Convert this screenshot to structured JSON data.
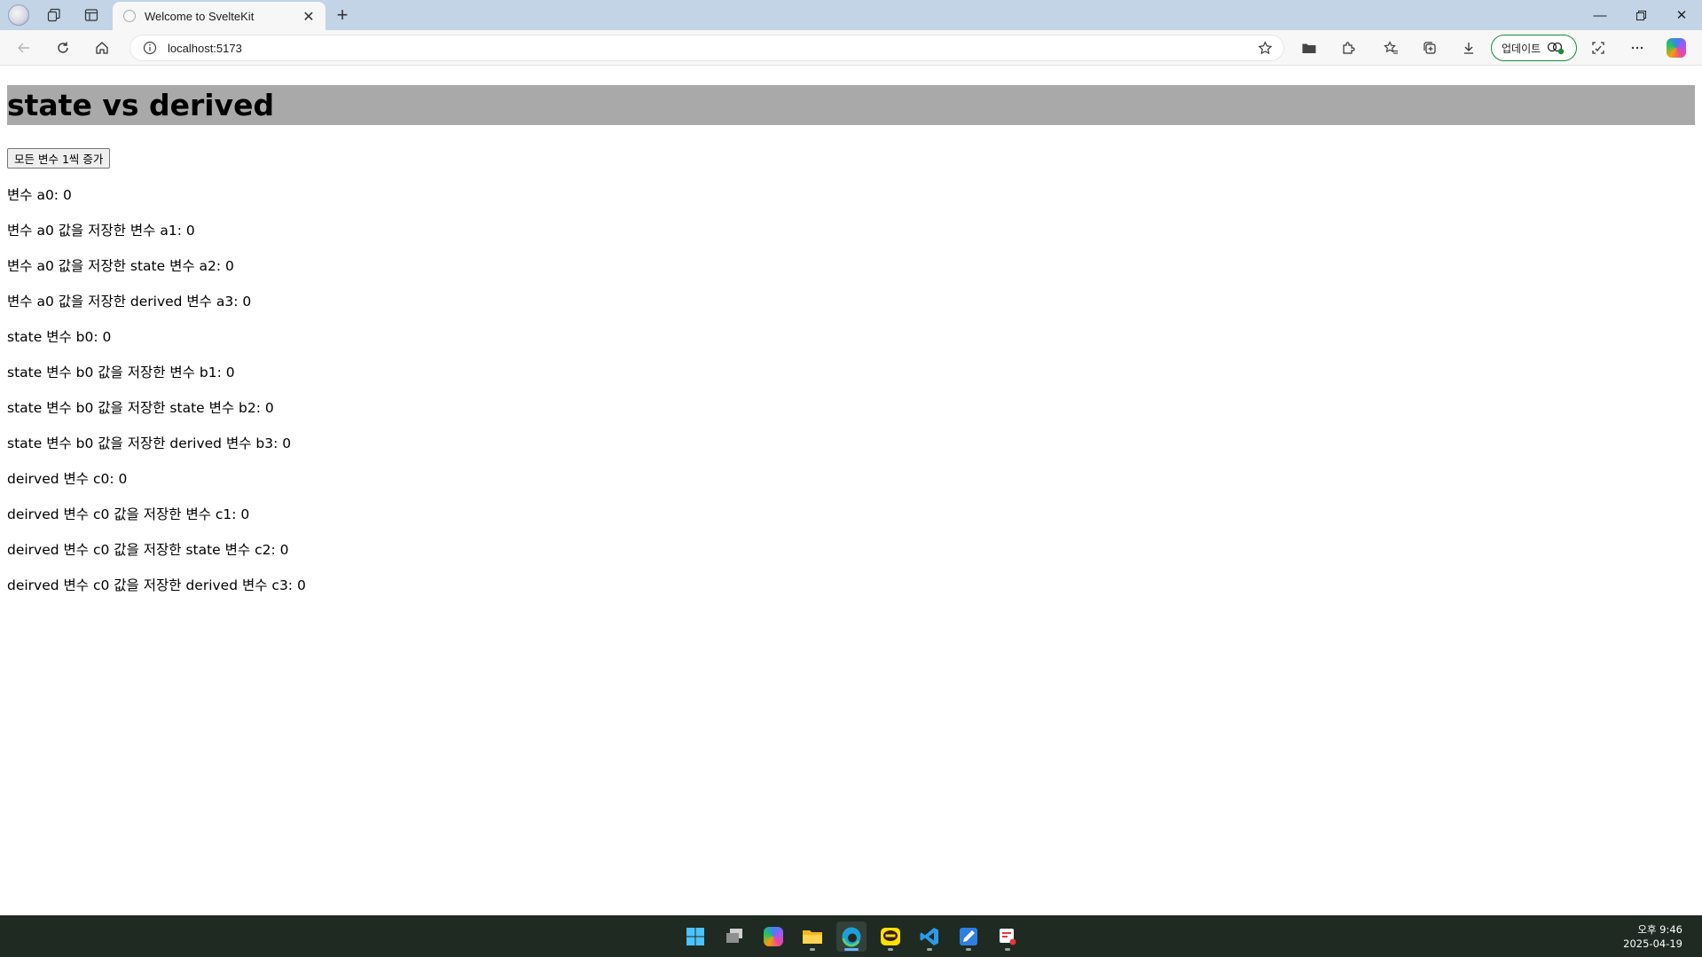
{
  "browser": {
    "tab_title": "Welcome to SvelteKit",
    "address": "localhost:5173",
    "update_label": "업데이트"
  },
  "page": {
    "title": "state vs derived",
    "increment_button": "모든 변수 1씩 증가",
    "lines": [
      "변수 a0: 0",
      "변수 a0 값을 저장한 변수 a1: 0",
      "변수 a0 값을 저장한 state 변수 a2: 0",
      "변수 a0 값을 저장한 derived 변수 a3: 0",
      "state 변수 b0: 0",
      "state 변수 b0 값을 저장한 변수 b1: 0",
      "state 변수 b0 값을 저장한 state 변수 b2: 0",
      "state 변수 b0 값을 저장한 derived 변수 b3: 0",
      "deirved 변수 c0: 0",
      "deirved 변수 c0 값을 저장한 변수 c1: 0",
      "deirved 변수 c0 값을 저장한 state 변수 c2: 0",
      "deirved 변수 c0 값을 저장한 derived 변수 c3: 0"
    ]
  },
  "taskbar": {
    "time": "오후 9:46",
    "date": "2025-04-19",
    "apps": [
      "start-icon",
      "task-view-icon",
      "copilot-app-icon",
      "file-explorer-icon",
      "edge-icon",
      "kakaotalk-icon",
      "vscode-icon",
      "paint-icon",
      "snipping-tool-icon"
    ]
  },
  "colors": {
    "tabstrip": "#c2d4e6",
    "heading_bg": "#a9a9a9",
    "taskbar": "#1e2a22",
    "update_border": "#1c8a3a"
  }
}
